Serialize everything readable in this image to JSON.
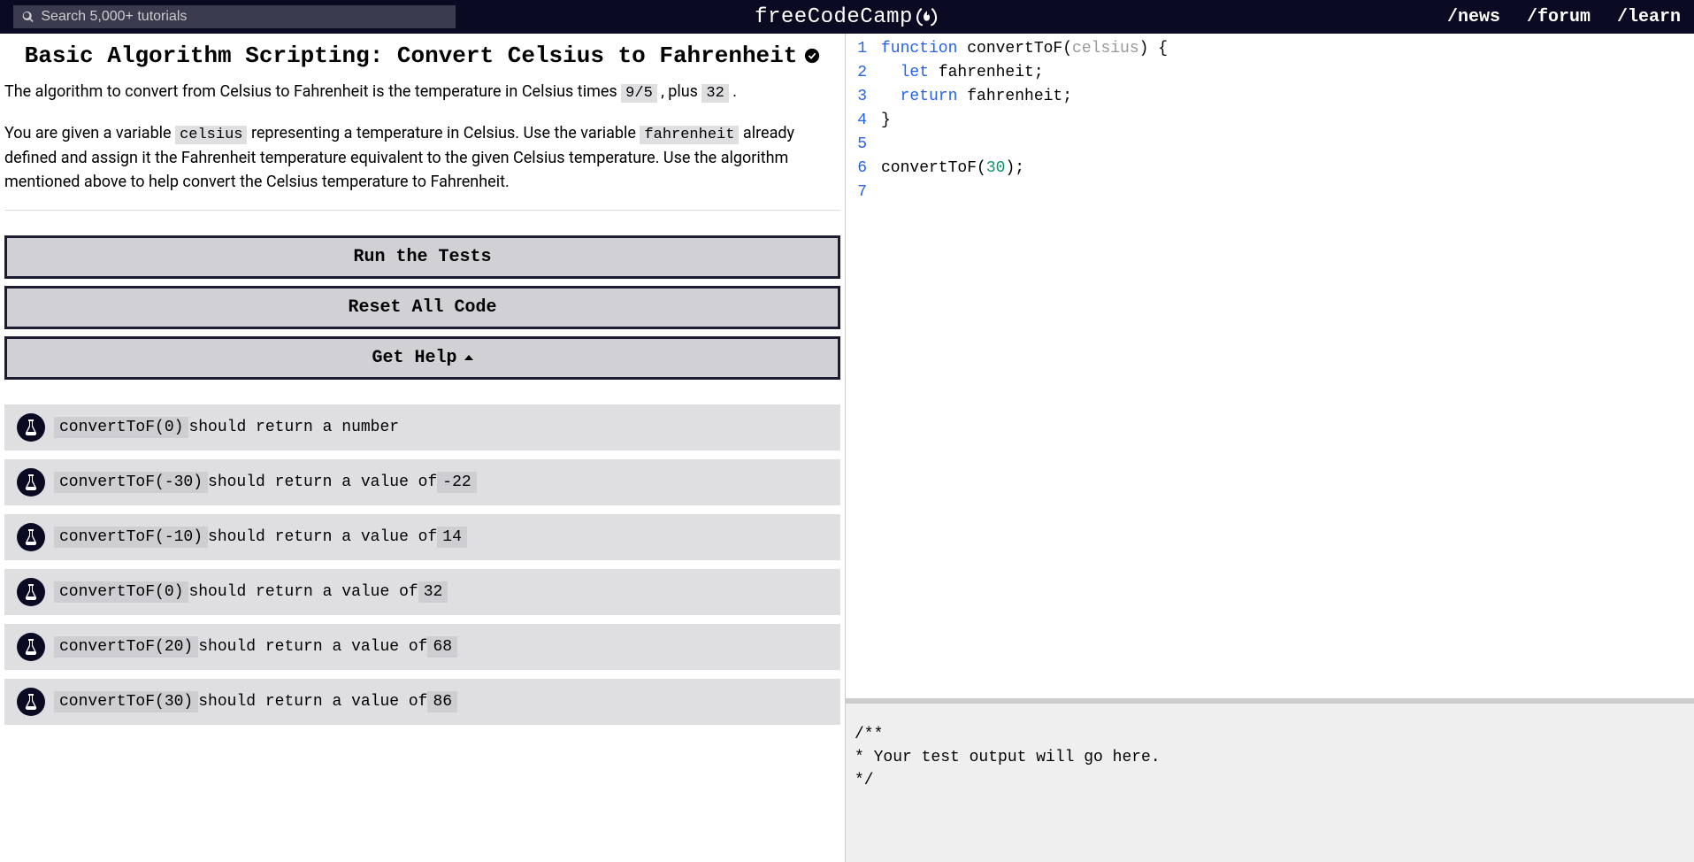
{
  "nav": {
    "search_placeholder": "Search 5,000+ tutorials",
    "brand": "freeCodeCamp",
    "links": [
      "/news",
      "/forum",
      "/learn"
    ]
  },
  "challenge": {
    "title": "Basic Algorithm Scripting: Convert Celsius to Fahrenheit",
    "desc1_pre": "The algorithm to convert from Celsius to Fahrenheit is the temperature in Celsius times ",
    "desc1_code1": "9/5",
    "desc1_mid": " , plus ",
    "desc1_code2": "32",
    "desc1_post": " .",
    "desc2_pre": "You are given a variable ",
    "desc2_code1": "celsius",
    "desc2_mid1": " representing a temperature in Celsius. Use the variable ",
    "desc2_code2": "fahrenheit",
    "desc2_post": " already defined and assign it the Fahrenheit temperature equivalent to the given Celsius temperature. Use the algorithm mentioned above to help convert the Celsius temperature to Fahrenheit."
  },
  "buttons": {
    "run": "Run the Tests",
    "reset": "Reset All Code",
    "help": "Get Help"
  },
  "tests": [
    {
      "code": "convertToF(0)",
      "text": " should return a number"
    },
    {
      "code": "convertToF(-30)",
      "text": " should return a value of ",
      "val": "-22"
    },
    {
      "code": "convertToF(-10)",
      "text": " should return a value of ",
      "val": "14"
    },
    {
      "code": "convertToF(0)",
      "text": " should return a value of ",
      "val": "32"
    },
    {
      "code": "convertToF(20)",
      "text": " should return a value of ",
      "val": "68"
    },
    {
      "code": "convertToF(30)",
      "text": " should return a value of ",
      "val": "86"
    }
  ],
  "editor": {
    "lines": [
      [
        {
          "t": "function ",
          "c": "kw"
        },
        {
          "t": "convertToF(",
          "c": ""
        },
        {
          "t": "celsius",
          "c": "param"
        },
        {
          "t": ") {",
          "c": ""
        }
      ],
      [
        {
          "t": "  let ",
          "c": "kw"
        },
        {
          "t": "fahrenheit;",
          "c": ""
        }
      ],
      [
        {
          "t": "  return ",
          "c": "kw"
        },
        {
          "t": "fahrenheit;",
          "c": ""
        }
      ],
      [
        {
          "t": "}",
          "c": ""
        }
      ],
      [],
      [
        {
          "t": "convertToF(",
          "c": ""
        },
        {
          "t": "30",
          "c": "num"
        },
        {
          "t": ");",
          "c": ""
        }
      ],
      []
    ]
  },
  "output": "/**\n* Your test output will go here.\n*/"
}
